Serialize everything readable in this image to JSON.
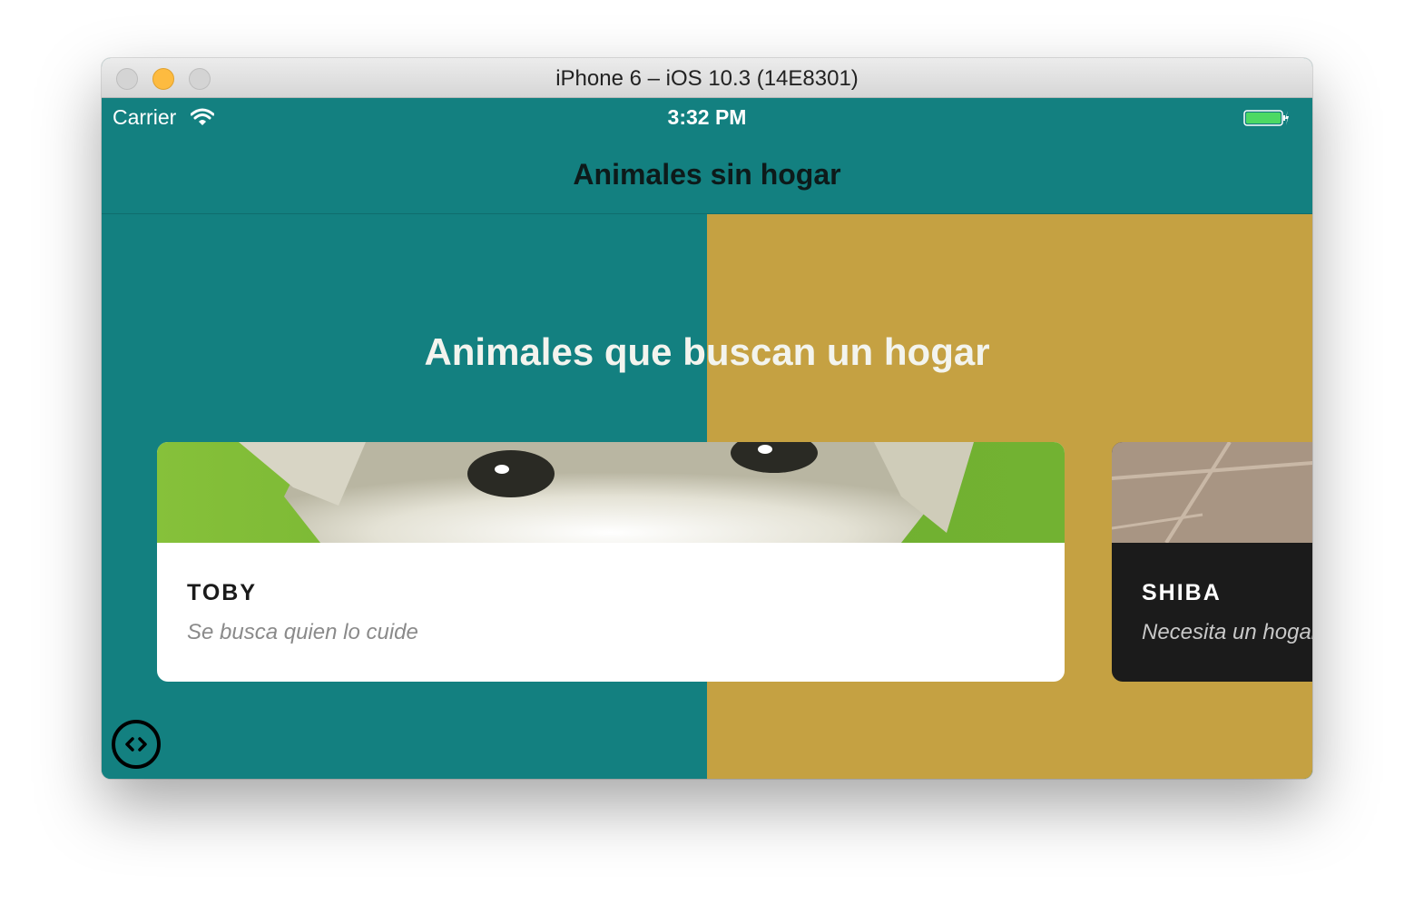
{
  "window": {
    "title": "iPhone 6 – iOS 10.3 (14E8301)"
  },
  "status_bar": {
    "carrier": "Carrier",
    "time": "3:32 PM",
    "icons": [
      "wifi-icon",
      "battery-icon"
    ]
  },
  "nav": {
    "title": "Animales sin hogar"
  },
  "main": {
    "headline": "Animales que buscan un hogar",
    "cards": [
      {
        "name": "TOBY",
        "subtitle": "Se busca quien lo cuide"
      },
      {
        "name": "SHIBA",
        "subtitle": "Necesita un hogar"
      }
    ]
  },
  "colors": {
    "teal": "#138080",
    "gold": "#c5a142",
    "card_light": "#ffffff",
    "card_dark": "#1b1b1b"
  },
  "dev_button_icon": "code-icon"
}
